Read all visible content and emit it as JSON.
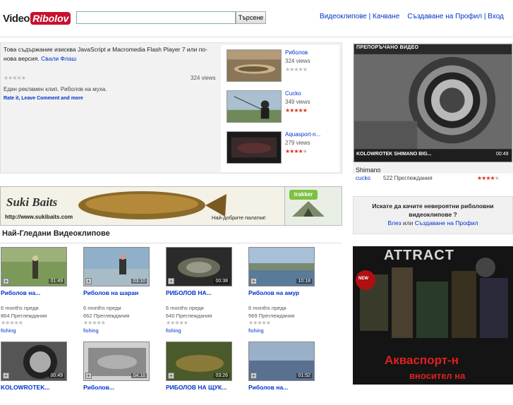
{
  "header": {
    "logo_part1": "Video",
    "logo_part2": "Ribolov",
    "search_placeholder": "",
    "search_button": "Търсене",
    "nav": [
      "Видеоклипове",
      "Качване",
      "Създаване на Профил",
      "Вход"
    ]
  },
  "flash": {
    "message": "Това съдържание изисква JavaScript и Macromedia Flash Player 7 или по-нова версия.",
    "download_link": "Свали Флаш",
    "views": "324 views",
    "description": "Един рекламен клип. Риболов на муха.",
    "action_links": "Rate it, Leave Comment and more",
    "rating": 0
  },
  "side_videos": [
    {
      "title": "Риболов",
      "views": "324 views",
      "rating": 0
    },
    {
      "title": "Cucko",
      "views": "349 views",
      "rating": 5
    },
    {
      "title": "Aquasport-n...",
      "views": "279 views",
      "rating": 4.5
    }
  ],
  "recommended": {
    "header": "ПРЕПОРЪЧАНО ВИДЕО",
    "caption": "KOLOWROTEK SHIMANO BIG...",
    "duration": "00:49",
    "title": "Shimano",
    "user": "cucko",
    "views": "522 Преглеждания",
    "rating": 4
  },
  "banner": {
    "brand": "Suki Baits",
    "url": "http://www.sukibaits.com",
    "brand2": "trakker",
    "slogan": "Най-добрите палатки!"
  },
  "signup": {
    "question": "Искате да качите невероятни риболовни видеоклипове ?",
    "login": "Влез",
    "or": "или",
    "register": "Създаване на Профил"
  },
  "most_viewed": {
    "title": "Най-Гледани Видеоклипове",
    "videos": [
      {
        "title": "Риболов на...",
        "duration": "01:49",
        "ago": "6 months преди",
        "views": "864 Преглеждания",
        "category": "fishing"
      },
      {
        "title": "Риболов на шаран",
        "duration": "03:10",
        "ago": "6 months преди",
        "views": "662 Преглеждания",
        "category": "fishing"
      },
      {
        "title": "РИБОЛОВ НА...",
        "duration": "00:38",
        "ago": "6 months преди",
        "views": "640 Преглеждания",
        "category": "fishing"
      },
      {
        "title": "Риболов на амур",
        "duration": "10:18",
        "ago": "6 months преди",
        "views": "569 Преглеждания",
        "category": "fishing"
      },
      {
        "title": "KOLOWROTEK...",
        "duration": "00:49",
        "ago": "",
        "views": "",
        "category": ""
      },
      {
        "title": "Риболов...",
        "duration": "04:18",
        "ago": "",
        "views": "",
        "category": ""
      },
      {
        "title": "РИБОЛОВ НА ЩУК...",
        "duration": "03:26",
        "ago": "",
        "views": "",
        "category": ""
      },
      {
        "title": "Риболов на...",
        "duration": "01:52",
        "ago": "",
        "views": "",
        "category": ""
      }
    ]
  },
  "ad": {
    "brand": "ATTRACT",
    "badge": "NEW",
    "text1": "Акваспорт-н",
    "text2": "вносител на"
  },
  "colors": {
    "link": "#0033cc",
    "star_on": "#dd3322",
    "star_off": "#bbbbbb",
    "logo_red": "#c8102e"
  }
}
